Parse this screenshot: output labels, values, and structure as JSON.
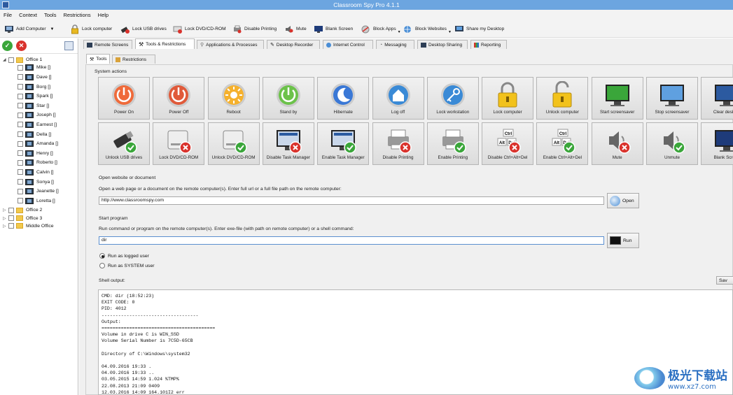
{
  "window": {
    "title": "Classroom Spy Pro 4.1.1"
  },
  "menu": [
    "File",
    "Context",
    "Tools",
    "Restrictions",
    "Help"
  ],
  "toolbar": {
    "items": [
      {
        "label": "Add Computer",
        "icon": "add-computer-icon"
      },
      {
        "label": "Lock computer",
        "icon": "lock-icon"
      },
      {
        "label": "Lock USB drives",
        "icon": "usb-lock-icon"
      },
      {
        "label": "Lock DVD/CD-ROM",
        "icon": "disc-lock-icon"
      },
      {
        "label": "Disable Printing",
        "icon": "printer-icon"
      },
      {
        "label": "Mute",
        "icon": "speaker-icon"
      },
      {
        "label": "Blank Screen",
        "icon": "monitor-icon"
      },
      {
        "label": "Block Apps",
        "icon": "block-apps-icon"
      },
      {
        "label": "Block Websites",
        "icon": "globe-icon"
      },
      {
        "label": "Share my Desktop",
        "icon": "share-desktop-icon"
      }
    ]
  },
  "tree": {
    "groups": [
      {
        "name": "Office 1",
        "expanded": true,
        "computers": [
          "Mike []",
          "Dave []",
          "Borg []",
          "Spark []",
          "Star []",
          "Joseph []",
          "Earnest []",
          "Della []",
          "Amanda []",
          "Henry []",
          "Roberto []",
          "Calvin []",
          "Sonya []",
          "Jeanette []",
          "Loretta []"
        ]
      },
      {
        "name": "Office 2",
        "expanded": false,
        "computers": []
      },
      {
        "name": "Office 3",
        "expanded": false,
        "computers": []
      },
      {
        "name": "Middle Office",
        "expanded": false,
        "computers": []
      }
    ]
  },
  "tabs": [
    {
      "label": "Remote Screens",
      "active": false
    },
    {
      "label": "Tools & Restrictions",
      "active": true
    },
    {
      "label": "Applications & Processes",
      "active": false
    },
    {
      "label": "Desktop Recorder",
      "active": false
    },
    {
      "label": "Internet Control",
      "active": false
    },
    {
      "label": "Messaging",
      "active": false
    },
    {
      "label": "Desktop Sharing",
      "active": false
    },
    {
      "label": "Reporting",
      "active": false
    }
  ],
  "subtabs": [
    {
      "label": "Tools",
      "active": true
    },
    {
      "label": "Restrictions",
      "active": false
    }
  ],
  "system_actions": {
    "label": "System actions",
    "row1": [
      "Power On",
      "Power Off",
      "Reboot",
      "Stand by",
      "Hibernate",
      "Log off",
      "Lock workstation",
      "Lock computer",
      "Unlock computer",
      "Start screensaver",
      "Stop screensaver",
      "Clear desktop"
    ],
    "row2": [
      "Unlock USB drives",
      "Lock DVD/CD-ROM",
      "Unlock DVD/CD-ROM",
      "Disable Task Manager",
      "Enable Task Manager",
      "Disable Printing",
      "Enable Printing",
      "Disable Ctrl+Alt+Del",
      "Enable Ctrl+Alt+Del",
      "Mute",
      "Unmute",
      "Blank Screen"
    ]
  },
  "open_website": {
    "label": "Open website or document",
    "hint": "Open a web page or a document on the remote computer(s). Enter full url or a full file path on the remote computer:",
    "value": "http://www.classroomspy.com",
    "button": "Open"
  },
  "start_program": {
    "label": "Start program",
    "hint": "Run command or program on the remote computer(s). Enter exe-file (with path on remote computer) or a shell command:",
    "value": "dir",
    "button": "Run",
    "options": [
      {
        "label": "Run as logged user",
        "selected": true
      },
      {
        "label": "Run as SYSTEM user",
        "selected": false
      }
    ]
  },
  "shell_output": {
    "label": "Shell output:",
    "save_button": "Sav",
    "lines": [
      "CMD: dir (18:52:23)",
      "EXIT CODE: 0",
      "PID: 4012",
      "-----------------------------------",
      "Output:",
      "=========================================",
      "Volume in drive C is WIN_SSD",
      "Volume Serial Number is 7C5D-65CB",
      "",
      "Directory of C:\\Windows\\system32",
      "",
      "04.09.2016 19:33 .",
      "04.09.2016 19:33 ..",
      "03.05.2015 14:59 1.024 %TMP%",
      "22.08.2013 21:09 0409",
      "12.03.2016 14:09 164.101I2 err"
    ]
  },
  "watermark": {
    "text_main": "极光下载站",
    "text_sub": "www.xz7.com"
  },
  "colors": {
    "titlebar": "#6ca5e0",
    "accent": "#2a6fc2",
    "green": "#3aa63a",
    "red": "#d9322c"
  }
}
